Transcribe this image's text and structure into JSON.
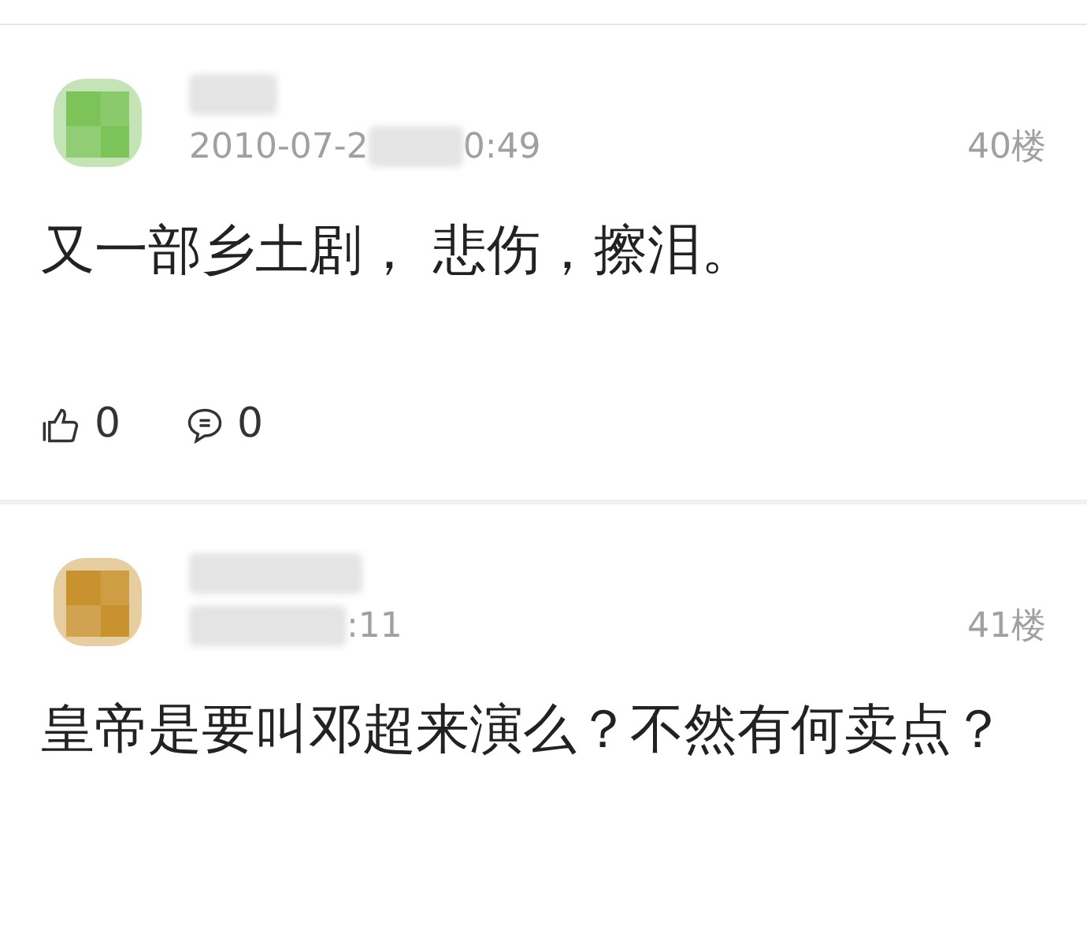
{
  "comments": [
    {
      "time_start": "2010-07-2",
      "time_end": "0:49",
      "floor": "40楼",
      "content": "又一部乡土剧， 悲伤，擦泪。",
      "likes": "0",
      "replies": "0"
    },
    {
      "time_end": ":11",
      "floor": "41楼",
      "content": "皇帝是要叫邓超来演么？不然有何卖点？"
    }
  ]
}
